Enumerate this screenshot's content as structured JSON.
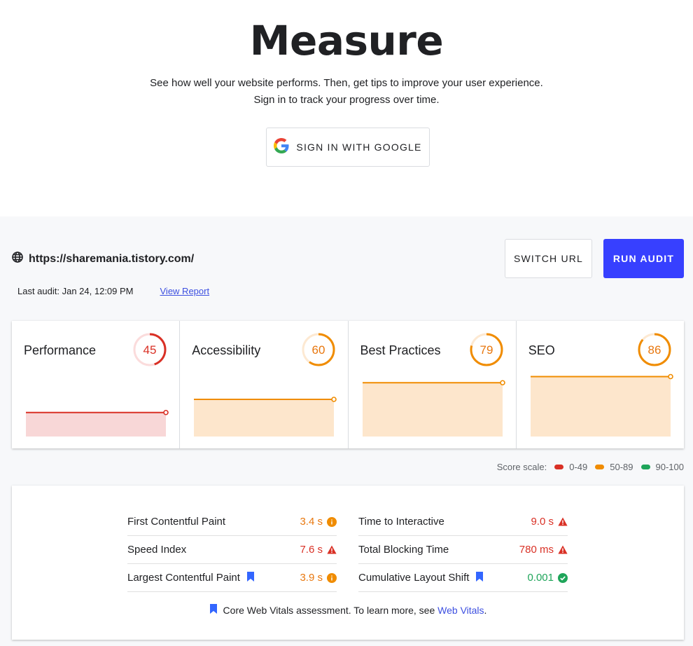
{
  "hero": {
    "title": "Measure",
    "subtitle_line1": "See how well your website performs. Then, get tips to improve your user experience.",
    "subtitle_line2": "Sign in to track your progress over time.",
    "google_button_label": "SIGN IN WITH GOOGLE",
    "google_icon": "google-g-icon"
  },
  "report": {
    "url": "https://sharemania.tistory.com/",
    "url_icon": "globe-icon",
    "last_audit": "Last audit: Jan 24, 12:09 PM",
    "view_report_label": "View Report",
    "switch_url_label": "SWITCH URL",
    "run_audit_label": "RUN AUDIT",
    "accent_color": "#3740ff"
  },
  "colors": {
    "fail": "#d93025",
    "fail_fill": "#f8d7d7",
    "fail_track": "#fbdcdc",
    "average": "#f08c00",
    "average_text": "#e8770e",
    "average_fill": "#fde6cc",
    "average_track": "#fde9d2",
    "pass": "#1fa55a",
    "link": "#3c4fe0",
    "bookmark": "#3366ff"
  },
  "categories": [
    {
      "name": "Performance",
      "score": 45,
      "rating": "fail"
    },
    {
      "name": "Accessibility",
      "score": 60,
      "rating": "average"
    },
    {
      "name": "Best Practices",
      "score": 79,
      "rating": "average"
    },
    {
      "name": "SEO",
      "score": 86,
      "rating": "average"
    }
  ],
  "score_scale": {
    "label": "Score scale:",
    "ranges": [
      {
        "label": "0-49",
        "rating": "fail"
      },
      {
        "label": "50-89",
        "rating": "average"
      },
      {
        "label": "90-100",
        "rating": "pass"
      }
    ]
  },
  "metrics": {
    "left": [
      {
        "name": "First Contentful Paint",
        "value": "3.4 s",
        "rating": "average",
        "icon": "info-circle-icon",
        "core": false
      },
      {
        "name": "Speed Index",
        "value": "7.6 s",
        "rating": "fail",
        "icon": "warning-triangle-icon",
        "core": false
      },
      {
        "name": "Largest Contentful Paint",
        "value": "3.9 s",
        "rating": "average",
        "icon": "info-circle-icon",
        "core": true
      }
    ],
    "right": [
      {
        "name": "Time to Interactive",
        "value": "9.0 s",
        "rating": "fail",
        "icon": "warning-triangle-icon",
        "core": false
      },
      {
        "name": "Total Blocking Time",
        "value": "780 ms",
        "rating": "fail",
        "icon": "warning-triangle-icon",
        "core": false
      },
      {
        "name": "Cumulative Layout Shift",
        "value": "0.001",
        "rating": "pass",
        "icon": "check-circle-icon",
        "core": true
      }
    ],
    "footnote_text": "Core Web Vitals assessment. To learn more, see ",
    "footnote_link": "Web Vitals",
    "footnote_end": "."
  }
}
